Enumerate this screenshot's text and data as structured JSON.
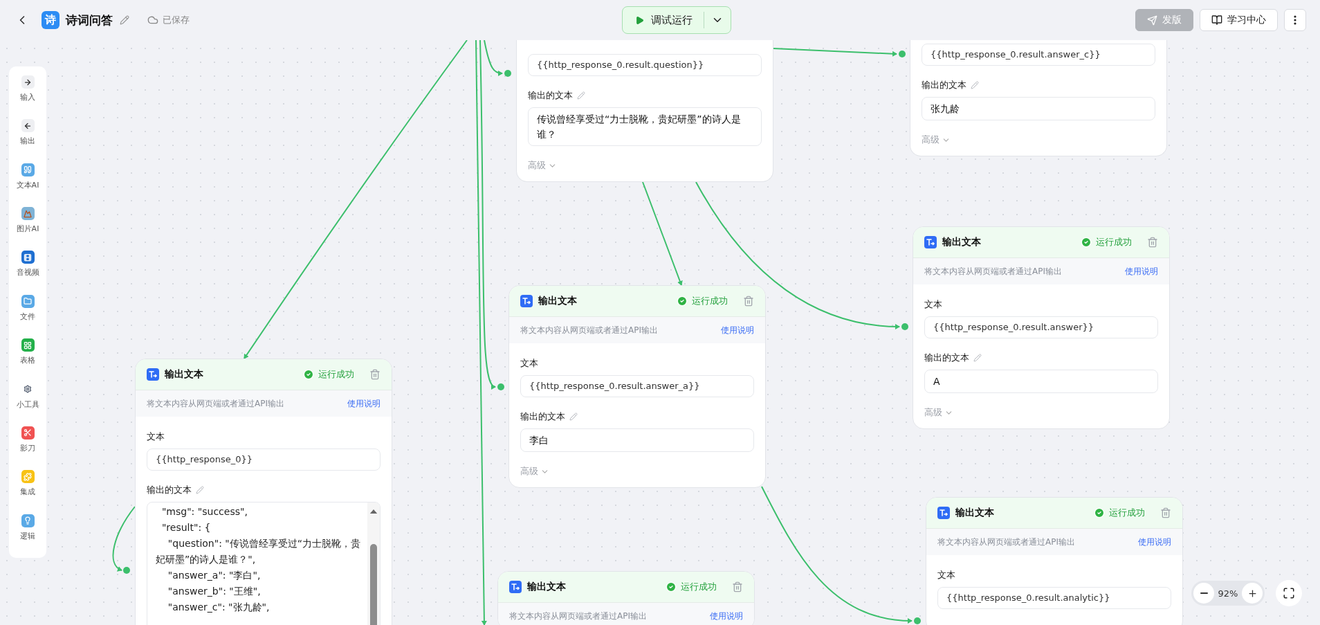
{
  "header": {
    "logo": "诗",
    "title": "诗词问答",
    "save_status": "已保存",
    "run_button": "调试运行",
    "actions": [
      {
        "label": "发版",
        "disabled": true
      },
      {
        "label": "学习中心",
        "disabled": false
      }
    ]
  },
  "sidebar": {
    "items": [
      {
        "label": "输入"
      },
      {
        "label": "输出"
      },
      {
        "label": "文本AI"
      },
      {
        "label": "图片AI"
      },
      {
        "label": "音视频"
      },
      {
        "label": "文件"
      },
      {
        "label": "表格"
      },
      {
        "label": "小工具"
      },
      {
        "label": "影刀"
      },
      {
        "label": "集成"
      },
      {
        "label": "逻辑"
      }
    ]
  },
  "nodes": [
    {
      "text_value": "{{http_response_0.result.question}}",
      "output_label": "输出的文本",
      "output": "传说曾经享受过“力士脱靴，贵妃研墨”的诗人是谁？",
      "advanced": "高级"
    },
    {
      "text_value": "{{http_response_0.result.answer_c}}",
      "output_label": "输出的文本",
      "output": "张九龄",
      "advanced": "高级"
    },
    {
      "title": "输出文本",
      "status": "运行成功",
      "description": "将文本内容从网页端或者通过API输出",
      "help_link": "使用说明",
      "text_label": "文本",
      "text_value": "{{http_response_0.result.answer}}",
      "output_label": "输出的文本",
      "output": "A",
      "advanced": "高级"
    },
    {
      "title": "输出文本",
      "status": "运行成功",
      "description": "将文本内容从网页端或者通过API输出",
      "help_link": "使用说明",
      "text_label": "文本",
      "text_value": "{{http_response_0.result.answer_a}}",
      "output_label": "输出的文本",
      "output": "李白",
      "advanced": "高级"
    },
    {
      "title": "输出文本",
      "status": "运行成功",
      "description": "将文本内容从网页端或者通过API输出",
      "help_link": "使用说明",
      "text_label": "文本",
      "text_value": "{{http_response_0}}",
      "output_label": "输出的文本",
      "output_lines": [
        "  \"msg\": \"success\",",
        "  \"result\": {",
        "    \"question\": \"传说曾经享受过“力士脱靴，贵妃研墨”的诗人是谁？\",",
        "    \"answer_a\": \"李白\",",
        "    \"answer_b\": \"王维\",",
        "    \"answer_c\": \"张九龄\","
      ]
    },
    {
      "title": "输出文本",
      "status": "运行成功",
      "description": "将文本内容从网页端或者通过API输出",
      "help_link": "使用说明",
      "text_label": "文本",
      "text_value": "{{http_response_0.result.analytic}}"
    },
    {
      "title": "输出文本",
      "status": "运行成功",
      "description": "将文本内容从网页端或者通过API输出",
      "help_link": "使用说明"
    }
  ],
  "zoom": {
    "value": "92%"
  }
}
